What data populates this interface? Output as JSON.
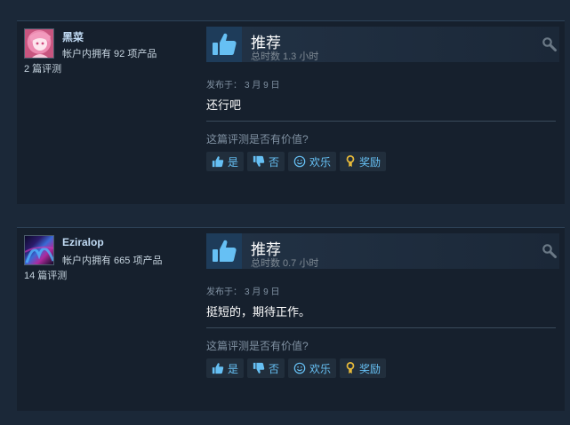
{
  "reviews": [
    {
      "username": "黑菜",
      "owned_text": "帐户内拥有 92 项产品",
      "review_count": "2 篇评测",
      "recommendation": "推荐",
      "hours_label": "总时数",
      "hours_value": "1.3 小时",
      "posted_label": "发布于：",
      "posted_date": "3 月 9 日",
      "content": "还行吧",
      "helpful_prompt": "这篇评测是否有价值?",
      "buttons": {
        "yes": "是",
        "no": "否",
        "funny": "欢乐",
        "award": "奖励"
      },
      "avatar_icon": "anime-girl-avatar"
    },
    {
      "username": "Eziralop",
      "owned_text": "帐户内拥有 665 项产品",
      "review_count": "14 篇评测",
      "recommendation": "推荐",
      "hours_label": "总时数",
      "hours_value": "0.7 小时",
      "posted_label": "发布于：",
      "posted_date": "3 月 9 日",
      "content": "挺短的，期待正作。",
      "helpful_prompt": "这篇评测是否有价值?",
      "buttons": {
        "yes": "是",
        "no": "否",
        "funny": "欢乐",
        "award": "奖励"
      },
      "avatar_icon": "nebula-avatar"
    }
  ],
  "colors": {
    "background": "#1b2838",
    "card": "#16202d",
    "link": "#66c0f4",
    "username": "#c1dbf4",
    "thumb_box": "#1e3c5a"
  },
  "icons": [
    "thumbs-up-icon",
    "thumbs-down-icon",
    "smiley-icon",
    "award-icon",
    "search-icon"
  ]
}
